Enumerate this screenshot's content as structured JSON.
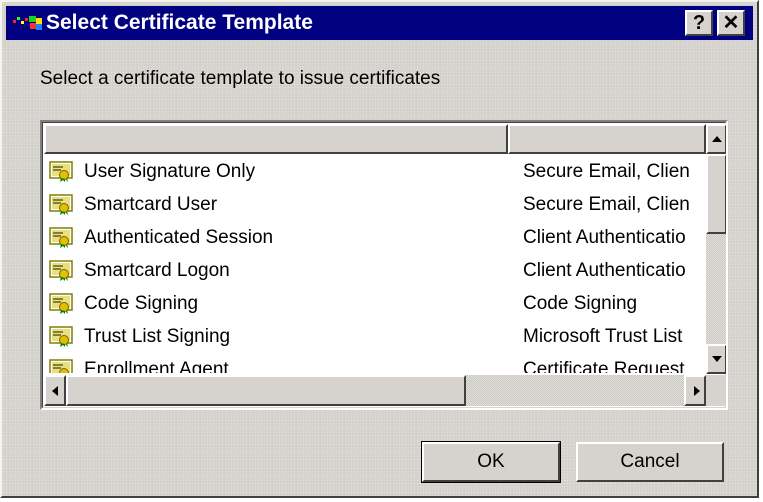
{
  "window": {
    "title": "Select Certificate Template",
    "help_label": "?",
    "close_label": "✕"
  },
  "prompt": "Select a certificate template to issue certificates",
  "list": {
    "columns": [
      "",
      ""
    ],
    "rows": [
      {
        "name": "User Signature Only",
        "purpose": "Secure Email, Clien"
      },
      {
        "name": "Smartcard User",
        "purpose": "Secure Email, Clien"
      },
      {
        "name": "Authenticated Session",
        "purpose": "Client Authenticatio"
      },
      {
        "name": "Smartcard Logon",
        "purpose": "Client Authenticatio"
      },
      {
        "name": "Code Signing",
        "purpose": "Code Signing"
      },
      {
        "name": "Trust List Signing",
        "purpose": "Microsoft Trust List"
      },
      {
        "name": "Enrollment Agent",
        "purpose": "Certificate Request"
      }
    ]
  },
  "buttons": {
    "ok_label": "OK",
    "cancel_label": "Cancel"
  },
  "colors": {
    "titlebar": "#000080",
    "face": "#d6d3ce"
  }
}
